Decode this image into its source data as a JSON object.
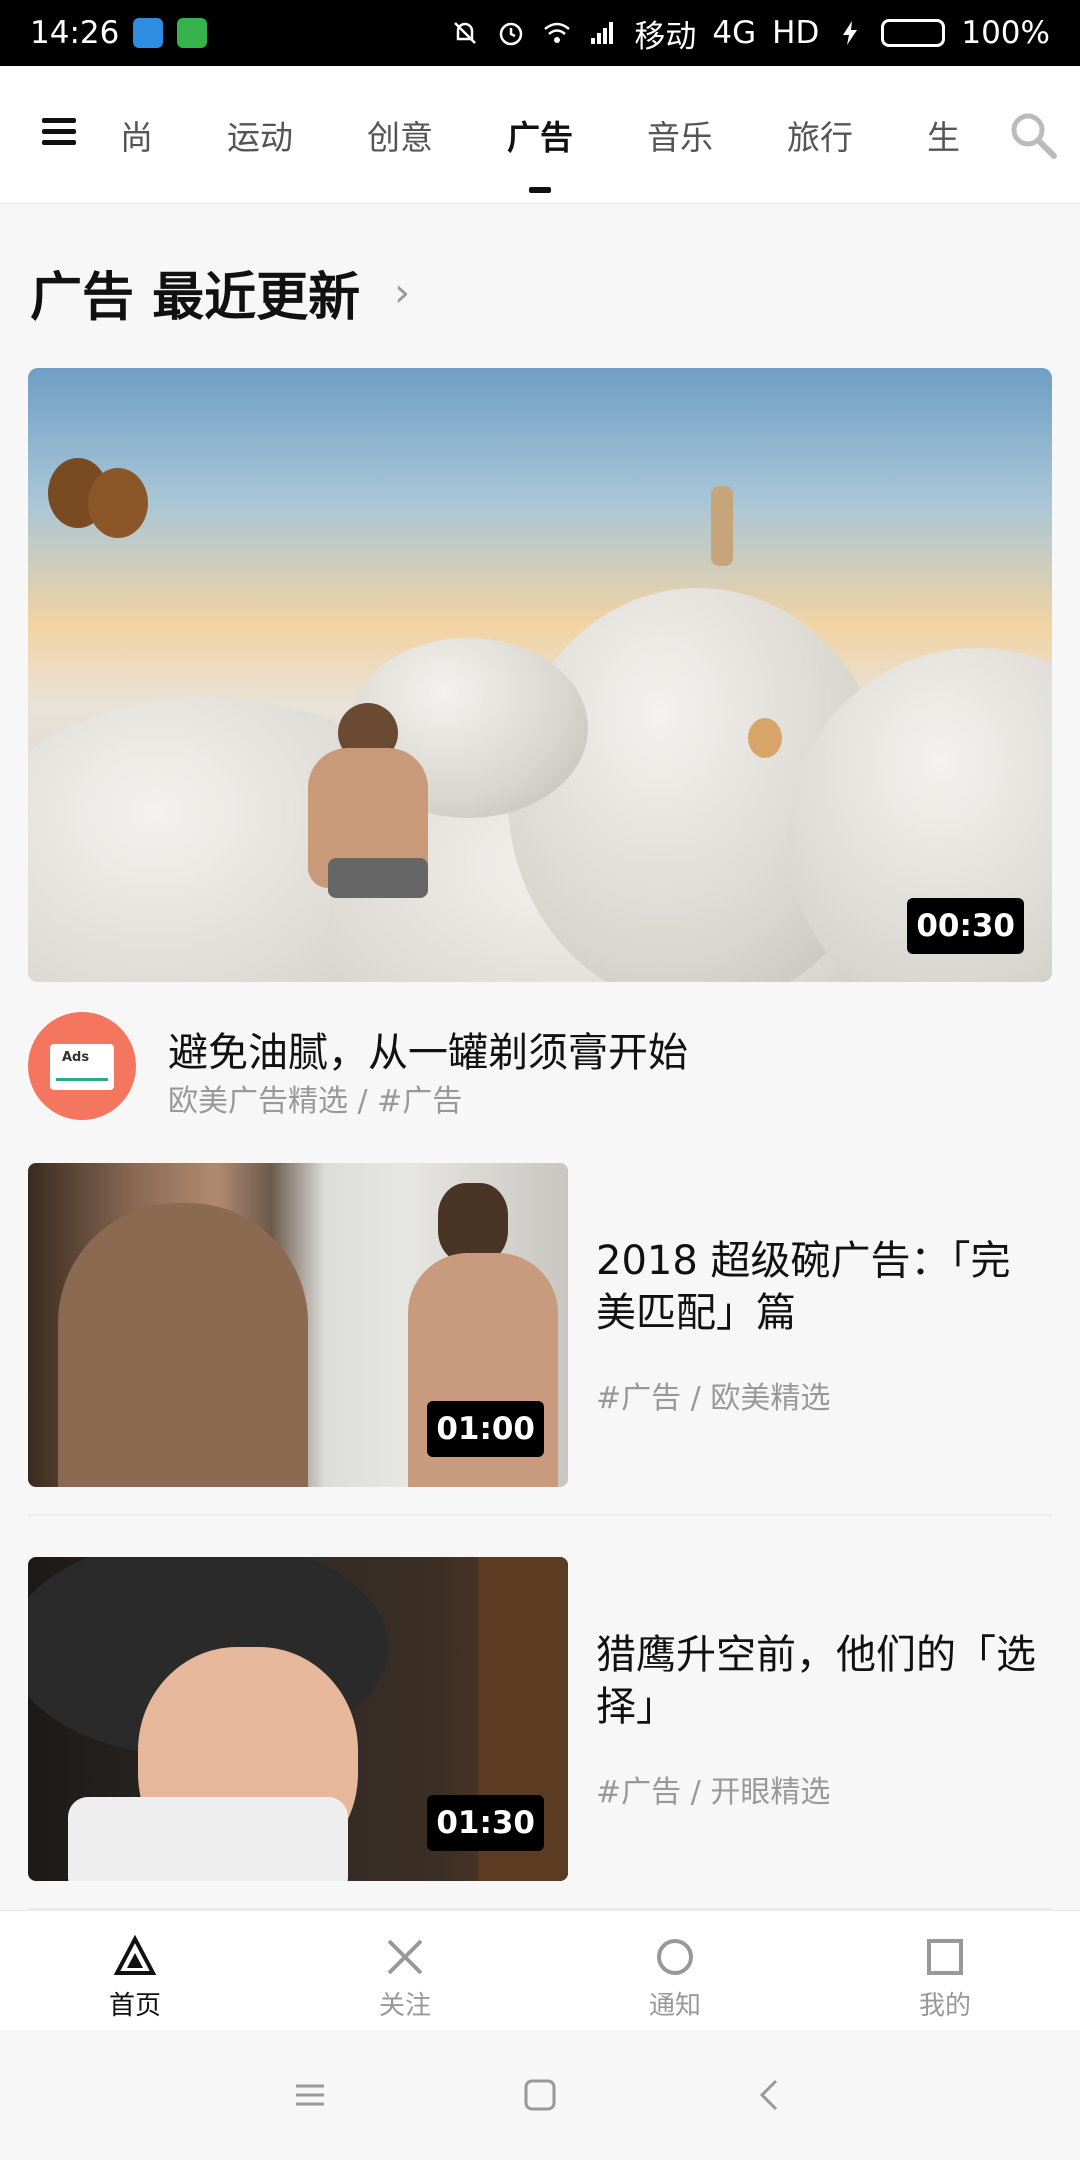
{
  "status_bar": {
    "time": "14:26",
    "carrier": "移动",
    "network": "4G",
    "hd": "HD",
    "battery": "100%",
    "battery_level": 1.0
  },
  "top_nav": {
    "tabs": [
      "尚",
      "运动",
      "创意",
      "广告",
      "音乐",
      "旅行",
      "生"
    ],
    "active_tab": "广告"
  },
  "section": {
    "title": "广告 最近更新",
    "chevron": "›"
  },
  "feature": {
    "duration": "00:30",
    "title": "避免油腻，从一罐剃须膏开始",
    "subtitle": "欧美广告精选 / #广告",
    "avatar_text": "Ads"
  },
  "list": [
    {
      "duration": "01:00",
      "title": "2018 超级碗广告：「完美匹配」篇",
      "subtitle": "#广告 / 欧美精选"
    },
    {
      "duration": "01:30",
      "title": "猎鹰升空前，他们的「选择」",
      "subtitle": "#广告 / 开眼精选"
    }
  ],
  "bottom_nav": {
    "items": [
      {
        "label": "首页",
        "icon": "triangle-home-icon"
      },
      {
        "label": "关注",
        "icon": "cross-follow-icon"
      },
      {
        "label": "通知",
        "icon": "circle-notify-icon"
      },
      {
        "label": "我的",
        "icon": "square-profile-icon"
      }
    ],
    "active": "首页"
  },
  "colors": {
    "avatar_bg": "#f4765f",
    "battery_fill": "#3fd34c"
  }
}
